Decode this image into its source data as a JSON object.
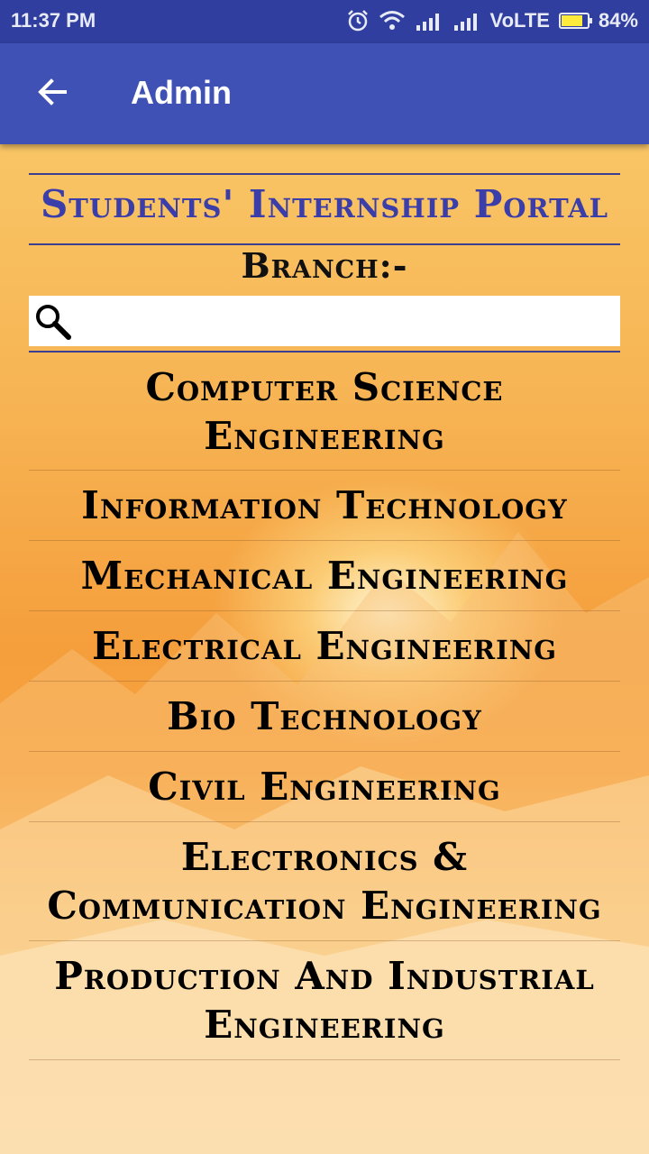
{
  "status_bar": {
    "time": "11:37 PM",
    "network_label": "VoLTE",
    "battery_percent": "84%",
    "battery_level": 0.84,
    "icons": [
      "alarm-icon",
      "wifi-icon",
      "signal-icon",
      "signal-icon",
      "battery-icon"
    ]
  },
  "app_bar": {
    "title": "Admin",
    "back_icon": "arrow-back-icon"
  },
  "portal": {
    "title": "Students' Internship Portal",
    "branch_label": "Branch:-"
  },
  "search": {
    "placeholder": "",
    "value": ""
  },
  "branches": [
    "Computer Science Engineering",
    "Information Technology",
    "Mechanical Engineering",
    "Electrical Engineering",
    "Bio Technology",
    "Civil Engineering",
    "Electronics & Communication Engineering",
    "Production And Industrial Engineering"
  ],
  "colors": {
    "status_bar": "#303f9f",
    "app_bar": "#3f51b5",
    "portal_title": "#3b3ea8",
    "battery_fill": "#ffeb3b"
  }
}
